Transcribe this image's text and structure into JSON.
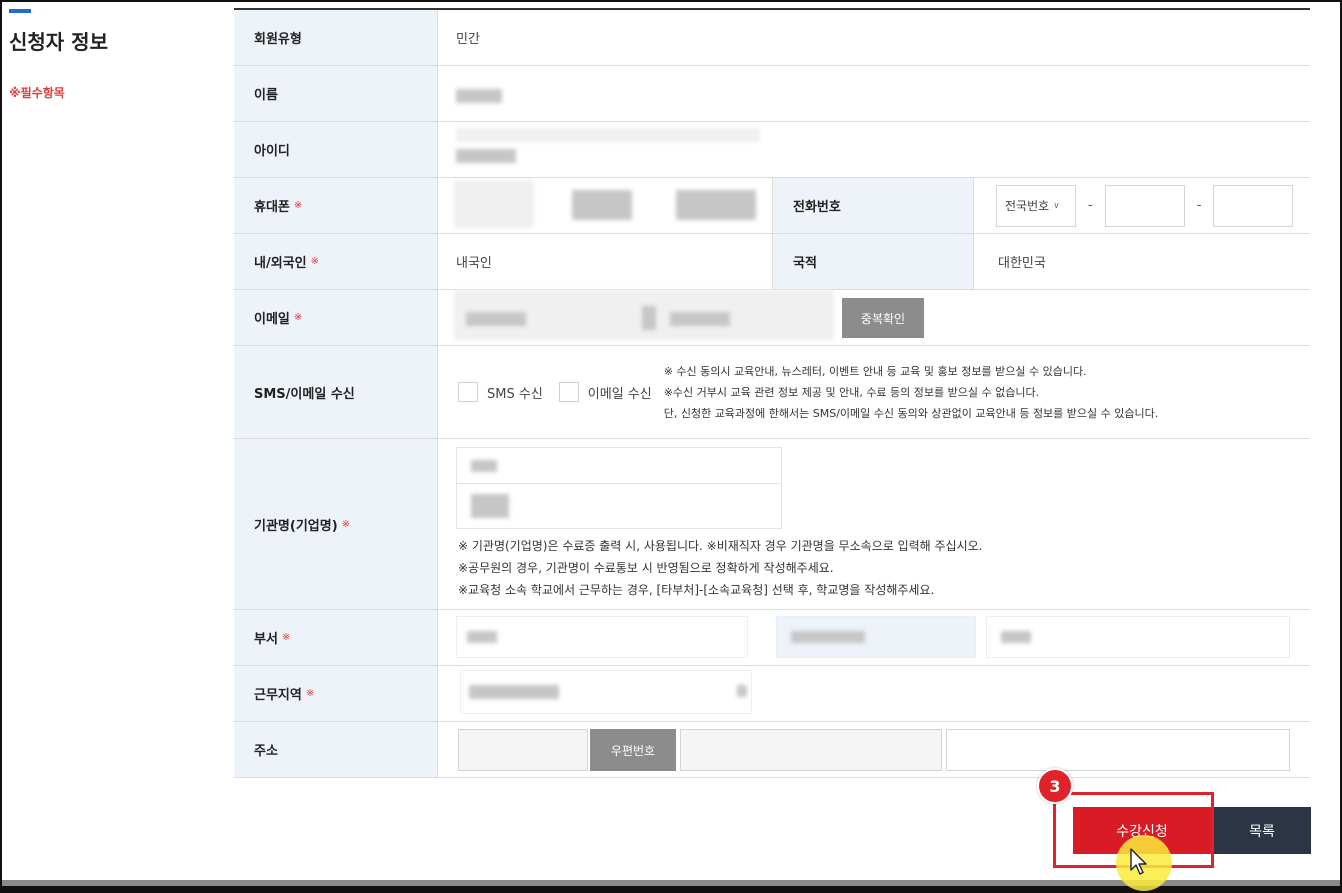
{
  "sidebar": {
    "title": "신청자 정보",
    "required_note": "※필수항목"
  },
  "form": {
    "member_type": {
      "label": "회원유형",
      "value": "민간"
    },
    "name": {
      "label": "이름"
    },
    "user_id": {
      "label": "아이디"
    },
    "mobile": {
      "label": "휴대폰",
      "req": "※"
    },
    "phone": {
      "label": "전화번호",
      "area_select": "전국번호",
      "sep1": "-",
      "sep2": "-"
    },
    "nationality_type": {
      "label": "내/외국인",
      "req": "※",
      "value": "내국인"
    },
    "country": {
      "label": "국적",
      "value": "대한민국"
    },
    "email": {
      "label": "이메일",
      "req": "※",
      "dup_check_button": "중복확인"
    },
    "sms_email": {
      "label": "SMS/이메일 수신",
      "sms_option": "SMS 수신",
      "email_option": "이메일 수신",
      "notices": [
        "※ 수신 동의시 교육안내, 뉴스레터, 이벤트 안내 등 교육 및 홍보 정보를 받으실 수 있습니다.",
        "※수신 거부시 교육 관련 정보 제공 및 안내, 수료 등의 정보를 받으실 수 없습니다.",
        "단, 신청한 교육과정에 한해서는 SMS/이메일 수신 동의와 상관없이 교육안내 등 정보를 받으실 수 있습니다."
      ]
    },
    "organization": {
      "label": "기관명(기업명)",
      "req": "※",
      "notices": [
        "※ 기관명(기업명)은 수료증 출력 시, 사용됩니다. ※비재직자 경우 기관명을 무소속으로 입력해 주십시오.",
        "※공무원의 경우, 기관명이 수료통보 시 반영됨으로 정확하게 작성해주세요.",
        "※교육청 소속 학교에서 근무하는 경우, [타부처]-[소속교육청] 선택 후, 학교명을 작성해주세요."
      ]
    },
    "department": {
      "label": "부서",
      "req": "※"
    },
    "work_region": {
      "label": "근무지역",
      "req": "※"
    },
    "address": {
      "label": "주소",
      "zip_button": "우편번호"
    }
  },
  "actions": {
    "apply_button": "수강신청",
    "list_button": "목록",
    "step_number": "3"
  },
  "colors": {
    "accent_blue": "#1f6fd1",
    "required_red": "#e23b3b",
    "apply_red": "#d81b25",
    "list_navy": "#2c3545",
    "header_bg": "#eef3fa"
  }
}
